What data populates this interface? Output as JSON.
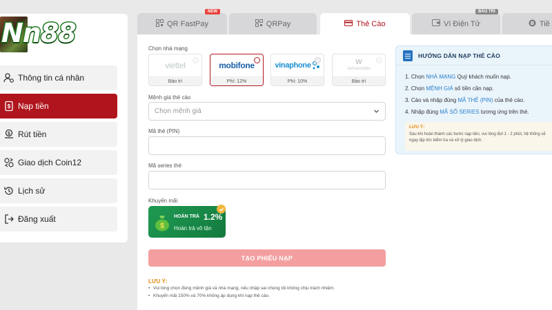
{
  "logo": {
    "text": "Nn88"
  },
  "sidebar": {
    "items": [
      {
        "label": "Thông tin cá nhân",
        "icon": "user-settings-icon"
      },
      {
        "label": "Nạp tiền",
        "icon": "deposit-icon",
        "active": true
      },
      {
        "label": "Rút tiền",
        "icon": "withdraw-icon"
      },
      {
        "label": "Giao dịch Coin12",
        "icon": "coin-exchange-icon"
      },
      {
        "label": "Lịch sử",
        "icon": "history-icon"
      },
      {
        "label": "Đăng xuất",
        "icon": "logout-icon"
      }
    ]
  },
  "tabs": [
    {
      "label": "QR FastPay",
      "badge": "NEW",
      "icon": "qr-icon"
    },
    {
      "label": "QRPay",
      "icon": "qr-icon"
    },
    {
      "label": "Thẻ Cào",
      "icon": "card-icon",
      "active": true
    },
    {
      "label": "Ví Điện Tử",
      "badge": "BẢO TRÌ",
      "icon": "wallet-icon"
    },
    {
      "label": "Tiề",
      "icon": "bitcoin-icon"
    }
  ],
  "form": {
    "network_label": "Chọn nhà mạng",
    "networks": [
      {
        "name": "viettel",
        "status": "Bảo trì"
      },
      {
        "name": "mobifone",
        "status": "Phí: 12%",
        "selected": true
      },
      {
        "name": "vinaphone",
        "status": "Phí: 10%"
      },
      {
        "name": "vietnamobile",
        "status": "Bảo trì"
      }
    ],
    "denomination_label": "Mệnh giá thẻ cào",
    "denomination_placeholder": "Chọn mệnh giá",
    "pin_label": "Mã thẻ (PIN)",
    "serial_label": "Mã series thẻ",
    "promo_label": "Khuyến mãi",
    "promo": {
      "line1": "HOÀN TRẢ",
      "percent": "1.2%",
      "line2": "Hoàn trả vô tận"
    },
    "submit_label": "TẠO PHIẾU NẠP",
    "notes_title": "LƯU Ý:",
    "notes": [
      "Vui lòng chọn đúng mệnh giá và nhà mạng, nếu nhập sai chúng tôi không chịu trách nhiệm.",
      "Khuyến mãi 150% và 70% không áp dụng khi nạp thẻ cào."
    ]
  },
  "guide": {
    "title": "HƯỚNG DẪN NẠP THẺ CÀO",
    "steps": [
      {
        "pre": "1. Chọn ",
        "hl": "NHÀ MẠNG",
        "post": " Quý khách muốn nạp."
      },
      {
        "pre": "2. Chọn ",
        "hl": "MỆNH GIÁ",
        "post": " số tiền cần nạp."
      },
      {
        "pre": "3. Cào và nhập đúng ",
        "hl": "MÃ THẺ (PIN)",
        "post": " của thẻ cào."
      },
      {
        "pre": "4. Nhập đúng ",
        "hl": "MÃ SỐ SERIES",
        "post": " tương ứng trên thẻ."
      }
    ],
    "note_title": "LƯU Ý:",
    "note_body": "Sau khi hoàn thành các bước nạp tiền, vui lòng đợi 1 - 2 phút, hệ thống sẽ ngay lập tức kiểm tra và xử lý giao dịch."
  },
  "colors": {
    "accent": "#b0151d",
    "link": "#2a7fc9",
    "promo": "#1f9a52",
    "submit": "#f49f9f"
  }
}
